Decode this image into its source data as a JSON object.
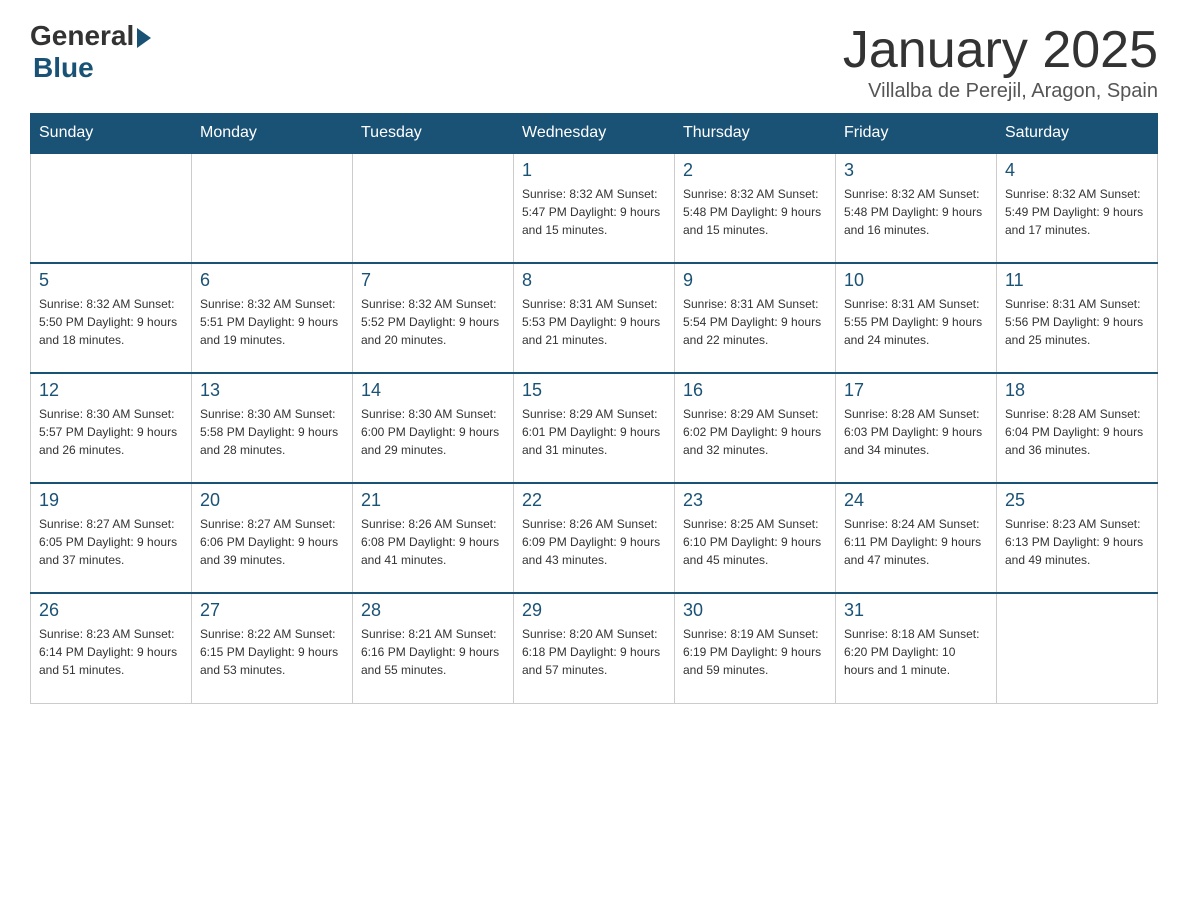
{
  "header": {
    "logo_general": "General",
    "logo_blue": "Blue",
    "month_title": "January 2025",
    "location": "Villalba de Perejil, Aragon, Spain"
  },
  "weekdays": [
    "Sunday",
    "Monday",
    "Tuesday",
    "Wednesday",
    "Thursday",
    "Friday",
    "Saturday"
  ],
  "weeks": [
    [
      {
        "day": "",
        "info": ""
      },
      {
        "day": "",
        "info": ""
      },
      {
        "day": "",
        "info": ""
      },
      {
        "day": "1",
        "info": "Sunrise: 8:32 AM\nSunset: 5:47 PM\nDaylight: 9 hours\nand 15 minutes."
      },
      {
        "day": "2",
        "info": "Sunrise: 8:32 AM\nSunset: 5:48 PM\nDaylight: 9 hours\nand 15 minutes."
      },
      {
        "day": "3",
        "info": "Sunrise: 8:32 AM\nSunset: 5:48 PM\nDaylight: 9 hours\nand 16 minutes."
      },
      {
        "day": "4",
        "info": "Sunrise: 8:32 AM\nSunset: 5:49 PM\nDaylight: 9 hours\nand 17 minutes."
      }
    ],
    [
      {
        "day": "5",
        "info": "Sunrise: 8:32 AM\nSunset: 5:50 PM\nDaylight: 9 hours\nand 18 minutes."
      },
      {
        "day": "6",
        "info": "Sunrise: 8:32 AM\nSunset: 5:51 PM\nDaylight: 9 hours\nand 19 minutes."
      },
      {
        "day": "7",
        "info": "Sunrise: 8:32 AM\nSunset: 5:52 PM\nDaylight: 9 hours\nand 20 minutes."
      },
      {
        "day": "8",
        "info": "Sunrise: 8:31 AM\nSunset: 5:53 PM\nDaylight: 9 hours\nand 21 minutes."
      },
      {
        "day": "9",
        "info": "Sunrise: 8:31 AM\nSunset: 5:54 PM\nDaylight: 9 hours\nand 22 minutes."
      },
      {
        "day": "10",
        "info": "Sunrise: 8:31 AM\nSunset: 5:55 PM\nDaylight: 9 hours\nand 24 minutes."
      },
      {
        "day": "11",
        "info": "Sunrise: 8:31 AM\nSunset: 5:56 PM\nDaylight: 9 hours\nand 25 minutes."
      }
    ],
    [
      {
        "day": "12",
        "info": "Sunrise: 8:30 AM\nSunset: 5:57 PM\nDaylight: 9 hours\nand 26 minutes."
      },
      {
        "day": "13",
        "info": "Sunrise: 8:30 AM\nSunset: 5:58 PM\nDaylight: 9 hours\nand 28 minutes."
      },
      {
        "day": "14",
        "info": "Sunrise: 8:30 AM\nSunset: 6:00 PM\nDaylight: 9 hours\nand 29 minutes."
      },
      {
        "day": "15",
        "info": "Sunrise: 8:29 AM\nSunset: 6:01 PM\nDaylight: 9 hours\nand 31 minutes."
      },
      {
        "day": "16",
        "info": "Sunrise: 8:29 AM\nSunset: 6:02 PM\nDaylight: 9 hours\nand 32 minutes."
      },
      {
        "day": "17",
        "info": "Sunrise: 8:28 AM\nSunset: 6:03 PM\nDaylight: 9 hours\nand 34 minutes."
      },
      {
        "day": "18",
        "info": "Sunrise: 8:28 AM\nSunset: 6:04 PM\nDaylight: 9 hours\nand 36 minutes."
      }
    ],
    [
      {
        "day": "19",
        "info": "Sunrise: 8:27 AM\nSunset: 6:05 PM\nDaylight: 9 hours\nand 37 minutes."
      },
      {
        "day": "20",
        "info": "Sunrise: 8:27 AM\nSunset: 6:06 PM\nDaylight: 9 hours\nand 39 minutes."
      },
      {
        "day": "21",
        "info": "Sunrise: 8:26 AM\nSunset: 6:08 PM\nDaylight: 9 hours\nand 41 minutes."
      },
      {
        "day": "22",
        "info": "Sunrise: 8:26 AM\nSunset: 6:09 PM\nDaylight: 9 hours\nand 43 minutes."
      },
      {
        "day": "23",
        "info": "Sunrise: 8:25 AM\nSunset: 6:10 PM\nDaylight: 9 hours\nand 45 minutes."
      },
      {
        "day": "24",
        "info": "Sunrise: 8:24 AM\nSunset: 6:11 PM\nDaylight: 9 hours\nand 47 minutes."
      },
      {
        "day": "25",
        "info": "Sunrise: 8:23 AM\nSunset: 6:13 PM\nDaylight: 9 hours\nand 49 minutes."
      }
    ],
    [
      {
        "day": "26",
        "info": "Sunrise: 8:23 AM\nSunset: 6:14 PM\nDaylight: 9 hours\nand 51 minutes."
      },
      {
        "day": "27",
        "info": "Sunrise: 8:22 AM\nSunset: 6:15 PM\nDaylight: 9 hours\nand 53 minutes."
      },
      {
        "day": "28",
        "info": "Sunrise: 8:21 AM\nSunset: 6:16 PM\nDaylight: 9 hours\nand 55 minutes."
      },
      {
        "day": "29",
        "info": "Sunrise: 8:20 AM\nSunset: 6:18 PM\nDaylight: 9 hours\nand 57 minutes."
      },
      {
        "day": "30",
        "info": "Sunrise: 8:19 AM\nSunset: 6:19 PM\nDaylight: 9 hours\nand 59 minutes."
      },
      {
        "day": "31",
        "info": "Sunrise: 8:18 AM\nSunset: 6:20 PM\nDaylight: 10 hours\nand 1 minute."
      },
      {
        "day": "",
        "info": ""
      }
    ]
  ]
}
